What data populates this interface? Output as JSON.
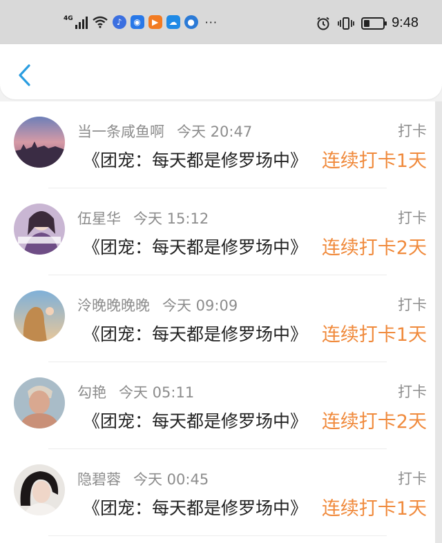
{
  "status_bar": {
    "network": "4G",
    "time": "9:48",
    "dots": "···"
  },
  "nav": {
    "back_icon": "chevron-left-icon",
    "accent": "#2a9de0"
  },
  "colors": {
    "streak": "#f08a3c",
    "meta": "#8c8c8c",
    "title": "#222222"
  },
  "items": [
    {
      "user": "当一条咸鱼啊",
      "time": "今天 20:47",
      "type": "打卡",
      "book": "《团宠：每天都是修罗场中》",
      "streak": "连续打卡1天"
    },
    {
      "user": "伍星华",
      "time": "今天 15:12",
      "type": "打卡",
      "book": "《团宠：每天都是修罗场中》",
      "streak": "连续打卡2天"
    },
    {
      "user": "泠晚晚晚晚",
      "time": "今天 09:09",
      "type": "打卡",
      "book": "《团宠：每天都是修罗场中》",
      "streak": "连续打卡1天"
    },
    {
      "user": "勾艳",
      "time": "今天 05:11",
      "type": "打卡",
      "book": "《团宠：每天都是修罗场中》",
      "streak": "连续打卡2天"
    },
    {
      "user": "隐碧蓉",
      "time": "今天 00:45",
      "type": "打卡",
      "book": "《团宠：每天都是修罗场中》",
      "streak": "连续打卡1天"
    }
  ]
}
